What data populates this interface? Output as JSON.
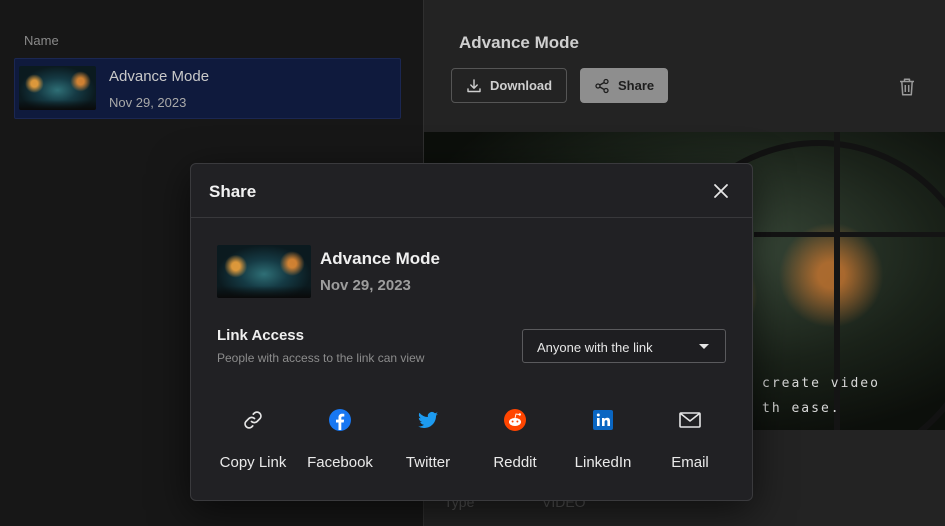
{
  "list": {
    "column_header": "Name",
    "items": [
      {
        "title": "Advance Mode",
        "date": "Nov 29, 2023"
      }
    ]
  },
  "detail": {
    "title": "Advance Mode",
    "download_label": "Download",
    "share_label": "Share",
    "preview_caption_line1": "create video",
    "preview_caption_line2": "th ease.",
    "meta": {
      "label": "Type",
      "value": "VIDEO"
    }
  },
  "modal": {
    "title": "Share",
    "item_title": "Advance Mode",
    "item_date": "Nov 29, 2023",
    "link_access_title": "Link Access",
    "link_access_desc": "People with access to the link can view",
    "link_access_value": "Anyone with the link",
    "options": [
      {
        "label": "Copy Link",
        "icon": "link-icon",
        "color": "#e6e6e6"
      },
      {
        "label": "Facebook",
        "icon": "facebook-icon",
        "color": "#1877f2"
      },
      {
        "label": "Twitter",
        "icon": "twitter-icon",
        "color": "#1d9bf0"
      },
      {
        "label": "Reddit",
        "icon": "reddit-icon",
        "color": "#ff4500"
      },
      {
        "label": "LinkedIn",
        "icon": "linkedin-icon",
        "color": "#0a66c2"
      },
      {
        "label": "Email",
        "icon": "email-icon",
        "color": "#e6e6e6"
      }
    ]
  },
  "colors": {
    "selected_row": "#0f1a3d",
    "modal_bg": "#212124",
    "share_button_bg": "#8e8e8e"
  }
}
